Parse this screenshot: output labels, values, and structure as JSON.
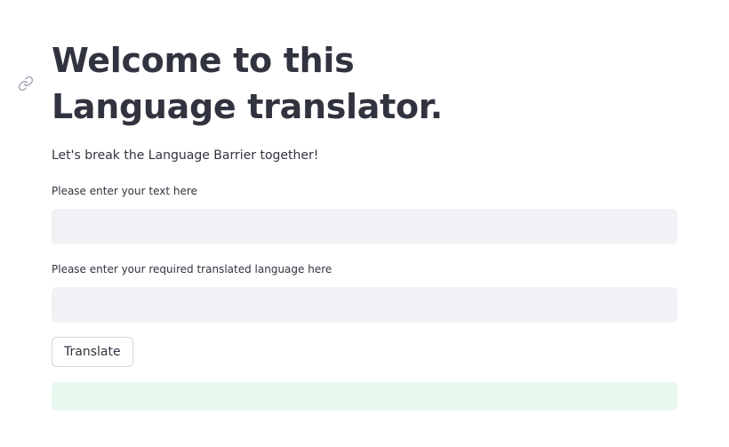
{
  "header": {
    "title": "Welcome to this Language translator.",
    "subtitle": "Let's break the Language Barrier together!"
  },
  "form": {
    "text_field": {
      "label": "Please enter your text here",
      "value": "",
      "placeholder": ""
    },
    "language_field": {
      "label": "Please enter your required translated language here",
      "value": "",
      "placeholder": ""
    },
    "translate_button_label": "Translate"
  },
  "result": {
    "text": ""
  },
  "icons": {
    "anchor": "link-icon"
  },
  "colors": {
    "text": "#31333f",
    "input_bg": "#f0f2f6",
    "success_bg": "#e8f8ee"
  }
}
